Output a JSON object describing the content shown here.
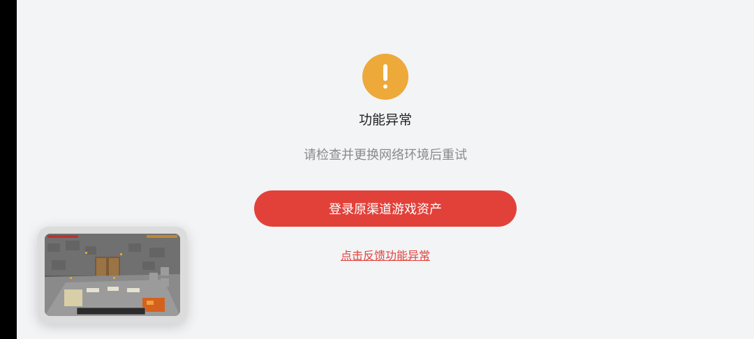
{
  "error": {
    "icon": "warning-exclamation-icon",
    "icon_color": "#eda93a",
    "title": "功能异常",
    "message": "请检查并更换网络环境后重试"
  },
  "actions": {
    "primary_label": "登录原渠道游戏资产",
    "primary_color": "#e2413a",
    "feedback_label": "点击反馈功能异常"
  },
  "floating_window": {
    "content": "game-preview-thumbnail"
  }
}
